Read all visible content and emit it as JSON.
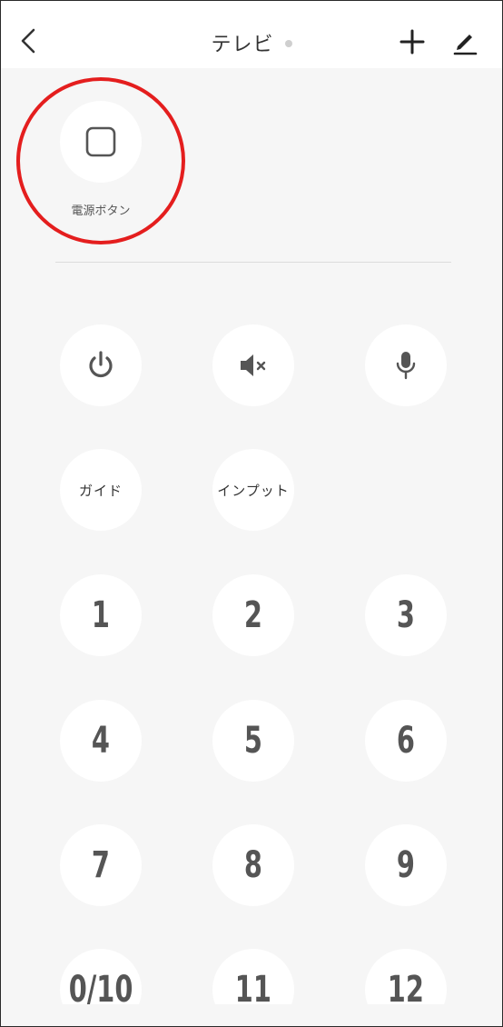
{
  "header": {
    "title": "テレビ",
    "status_color": "#cfcfcf"
  },
  "custom_button": {
    "label": "電源ボタン",
    "icon": "square-icon"
  },
  "annotation": {
    "color": "#e41e1e"
  },
  "controls": {
    "power_icon": "power-icon",
    "mute_icon": "mute-icon",
    "mic_icon": "mic-icon",
    "guide_label": "ガイド",
    "input_label": "インプット"
  },
  "numpad": [
    "1",
    "2",
    "3",
    "4",
    "5",
    "6",
    "7",
    "8",
    "9",
    "0/10",
    "11",
    "12"
  ]
}
